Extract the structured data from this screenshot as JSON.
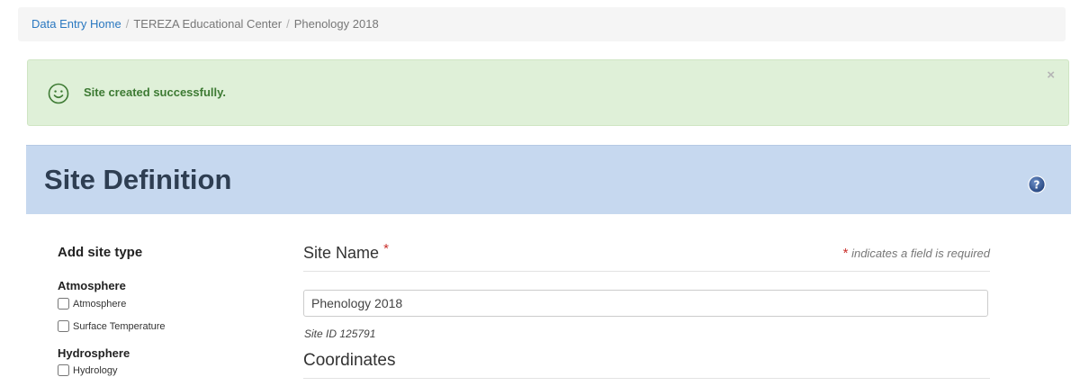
{
  "breadcrumb": {
    "home": "Data Entry Home",
    "separator": "/",
    "org": "TEREZA Educational Center",
    "site": "Phenology 2018"
  },
  "alert": {
    "message": "Site created successfully.",
    "close": "×",
    "icon": "smiley-icon"
  },
  "panel": {
    "title": "Site Definition",
    "help_icon": "question-mark-icon"
  },
  "sidebar": {
    "title": "Add site type",
    "groups": [
      {
        "title": "Atmosphere",
        "items": [
          "Atmosphere",
          "Surface Temperature"
        ]
      },
      {
        "title": "Hydrosphere",
        "items": [
          "Hydrology"
        ]
      }
    ]
  },
  "form": {
    "site_name_label": "Site Name",
    "required_star": "*",
    "required_note": "indicates a field is required",
    "site_name_value": "Phenology 2018",
    "site_id": "Site ID 125791",
    "coordinates_label": "Coordinates"
  },
  "colors": {
    "link": "#2a78c0",
    "alert_bg": "#dff0d8",
    "alert_text": "#3d7a33",
    "panel_bg": "#c6d8ef",
    "required": "#c9302c"
  }
}
